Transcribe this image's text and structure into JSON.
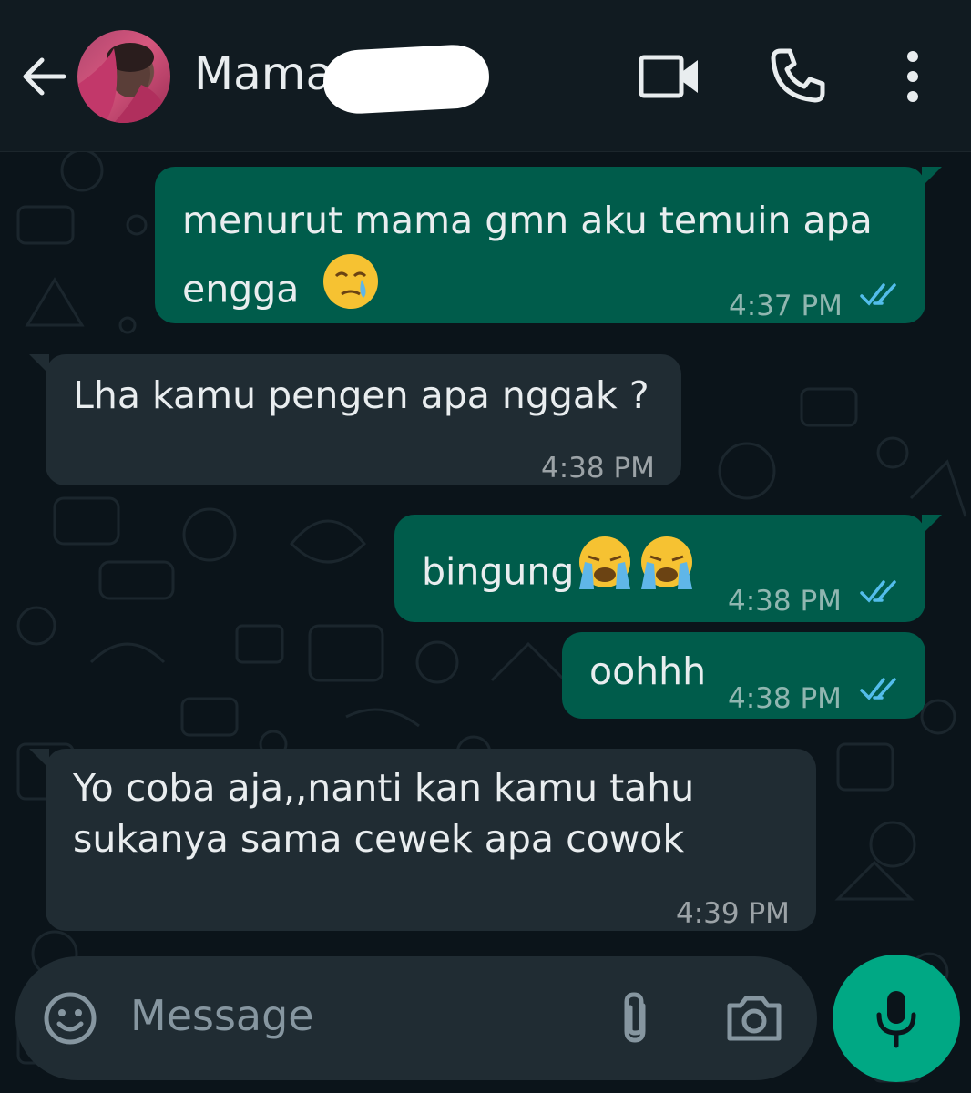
{
  "header": {
    "contact_name": "Mama",
    "icons": {
      "back": "arrow-left-icon",
      "video": "video-camera-icon",
      "call": "phone-icon",
      "more": "more-vertical-icon"
    }
  },
  "messages": [
    {
      "direction": "outgoing",
      "lines": [
        "menurut mama gmn aku temuin apa",
        "engga"
      ],
      "emoji": "crying-face",
      "time": "4:37 PM",
      "status": "read"
    },
    {
      "direction": "incoming",
      "lines": [
        "Lha kamu pengen apa nggak ?"
      ],
      "time": "4:38 PM"
    },
    {
      "direction": "outgoing",
      "lines": [
        "bingung"
      ],
      "emoji": "loudly-crying-face x2",
      "time": "4:38 PM",
      "status": "read"
    },
    {
      "direction": "outgoing",
      "lines": [
        "oohhh"
      ],
      "time": "4:38 PM",
      "status": "read"
    },
    {
      "direction": "incoming",
      "lines": [
        "Yo coba aja,,nanti kan kamu tahu",
        "sukanya sama cewek apa cowok"
      ],
      "time": "4:39 PM"
    }
  ],
  "composer": {
    "placeholder": "Message",
    "icons": {
      "emoji": "emoji-smile-icon",
      "attach": "paperclip-icon",
      "camera": "camera-icon",
      "mic": "microphone-icon"
    }
  },
  "colors": {
    "background": "#0b141a",
    "header": "#111b21",
    "outgoing_bubble": "#005c4b",
    "incoming_bubble": "#202c33",
    "read_ticks": "#53bdeb",
    "accent": "#00a884"
  }
}
